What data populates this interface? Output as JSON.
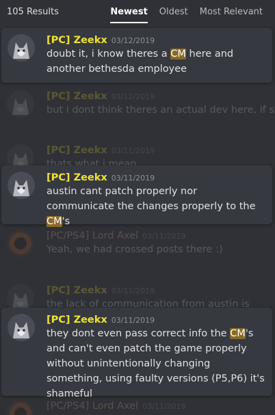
{
  "header": {
    "results_count": "105 Results",
    "tabs": [
      {
        "label": "Newest",
        "active": true
      },
      {
        "label": "Oldest",
        "active": false
      },
      {
        "label": "Most Relevant",
        "active": false
      }
    ]
  },
  "messages": [
    {
      "kind": "hit",
      "username": "[PC] Zeekx",
      "timestamp": "03/12/2019",
      "text": [
        "doubt it, i know theres a ",
        "CM",
        " here and another bethesda employee"
      ]
    },
    {
      "kind": "context",
      "username": "[PC] Zeekx",
      "timestamp": "03/12/2019",
      "text": "but i dont think theres an actual dev here, if so,"
    },
    {
      "kind": "context",
      "username": "[PC] Zeekx",
      "timestamp": "03/11/2019",
      "text": "thats what i mean"
    },
    {
      "kind": "hit",
      "username": "[PC] Zeekx",
      "timestamp": "03/11/2019",
      "text": [
        "austin cant patch properly nor communicate the changes properly to the ",
        "CM",
        "'s"
      ]
    },
    {
      "kind": "context",
      "username": "[PC/PS4] Lord Axel",
      "timestamp": "03/11/2019",
      "text": "Yeah, we had crossed posts there :)"
    },
    {
      "kind": "context",
      "username": "[PC] Zeekx",
      "timestamp": "03/11/2019",
      "text": "the lack of communication from austin is"
    },
    {
      "kind": "hit",
      "username": "[PC] Zeekx",
      "timestamp": "03/11/2019",
      "text": [
        "they dont even pass correct info the ",
        "CM",
        "'s and can't even patch the game properly without unintentionally changing something, using faulty versions (P5,P6) it's shameful"
      ]
    },
    {
      "kind": "context",
      "username": "[PC/PS4] Lord Axel",
      "timestamp": "03/11/2019",
      "text": ""
    }
  ],
  "colors": {
    "background": "#2f3136",
    "card": "#36393f",
    "username_zeekx": "#f0e332",
    "highlight": "#8a6a26"
  },
  "icons": {
    "avatar_zeekx": "wolf-avatar-icon",
    "avatar_axel": "lord-axel-avatar-icon"
  }
}
